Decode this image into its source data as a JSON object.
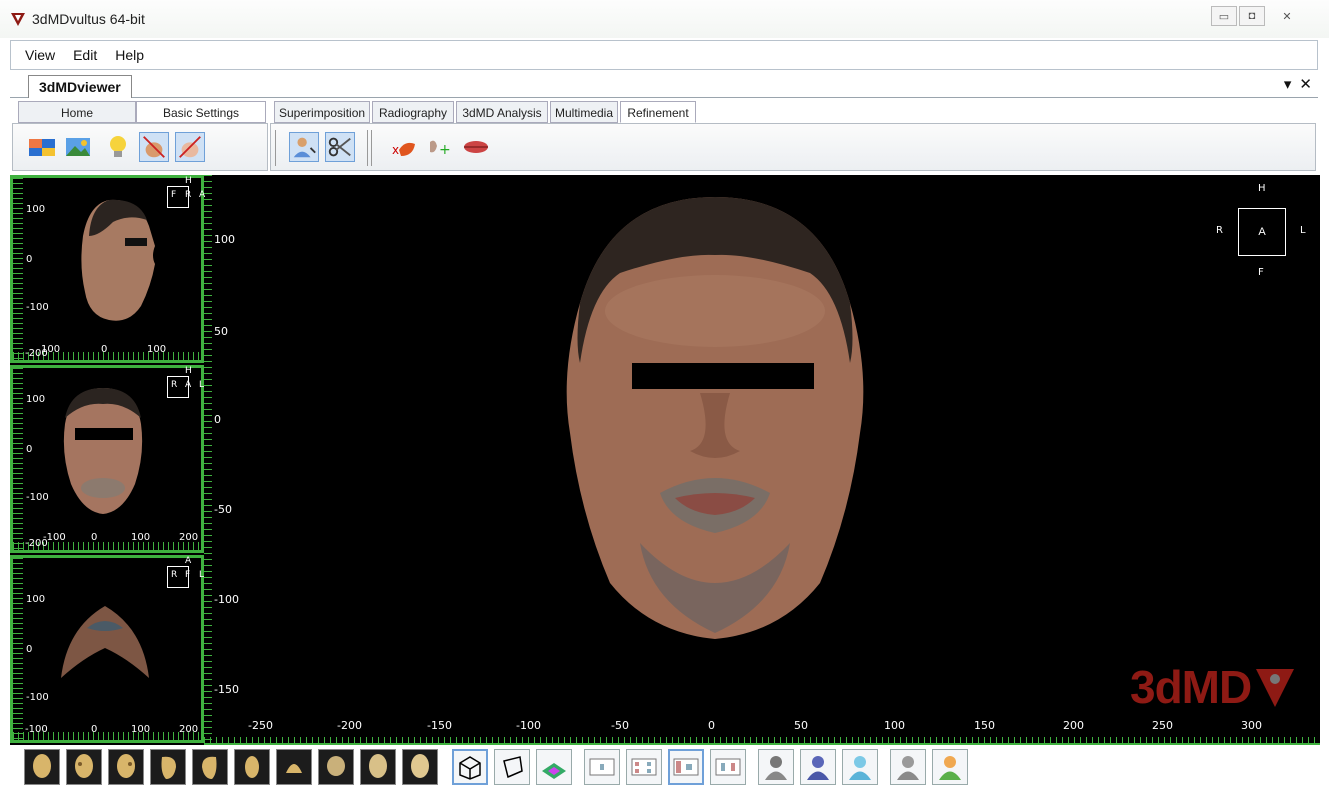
{
  "window": {
    "title": "3dMDvultus 64-bit"
  },
  "menu": {
    "items": [
      "View",
      "Edit",
      "Help"
    ]
  },
  "document": {
    "tab": "3dMDviewer",
    "dropdown_symbol": "▾",
    "close_symbol": "✕"
  },
  "ribbon": {
    "tabs": [
      "Home",
      "Basic Settings",
      "Superimposition",
      "Radiography",
      "3dMD Analysis",
      "Multimedia",
      "Refinement"
    ],
    "active_tab": "Refinement"
  },
  "viewport": {
    "thumb_side": {
      "y_ticks": [
        "100",
        "0",
        "-100"
      ],
      "x_ticks": [
        "-200",
        "100",
        "0",
        "100"
      ],
      "orient": [
        "H",
        "F",
        "R",
        "A",
        "P"
      ]
    },
    "thumb_front": {
      "y_ticks": [
        "100",
        "0",
        "-100"
      ],
      "x_ticks": [
        "-200",
        "-100",
        "0",
        "100",
        "200"
      ],
      "orient": [
        "H",
        "R",
        "A",
        "L",
        "F"
      ]
    },
    "thumb_bottom": {
      "y_ticks": [
        "100",
        "0",
        "-100"
      ],
      "x_ticks": [
        "-100",
        "0",
        "100",
        "200"
      ],
      "orient": [
        "A",
        "R",
        "F",
        "L",
        "P"
      ]
    },
    "vertical_ticks": [
      "100",
      "50",
      "0",
      "-50",
      "-100",
      "-150"
    ],
    "horizontal_ticks": [
      "-250",
      "-200",
      "-150",
      "-100",
      "-50",
      "0",
      "50",
      "100",
      "150",
      "200",
      "250",
      "300"
    ],
    "orientation": {
      "top": "H",
      "left": "R",
      "center": "A",
      "right": "L",
      "bottom": "F"
    },
    "watermark": "3dMD"
  },
  "colors": {
    "ruler_green": "#3fb13f",
    "watermark_red": "#8e1a14",
    "viewport_bg": "#000000"
  },
  "bottom_toolbar": {
    "head_views": [
      "head-view-1",
      "head-view-2",
      "head-view-3",
      "head-view-4",
      "head-view-5",
      "head-view-6",
      "head-view-7",
      "head-view-8",
      "head-view-9",
      "head-view-10"
    ],
    "render_modes": [
      "wireframe-cube",
      "perspective-cube",
      "texture-mode"
    ],
    "layouts": [
      "layout-single",
      "layout-quad",
      "layout-side",
      "layout-dual"
    ],
    "users": [
      "mesh-user-gray",
      "mesh-user-blue",
      "user-cyan",
      "user-gray",
      "user-green"
    ]
  }
}
